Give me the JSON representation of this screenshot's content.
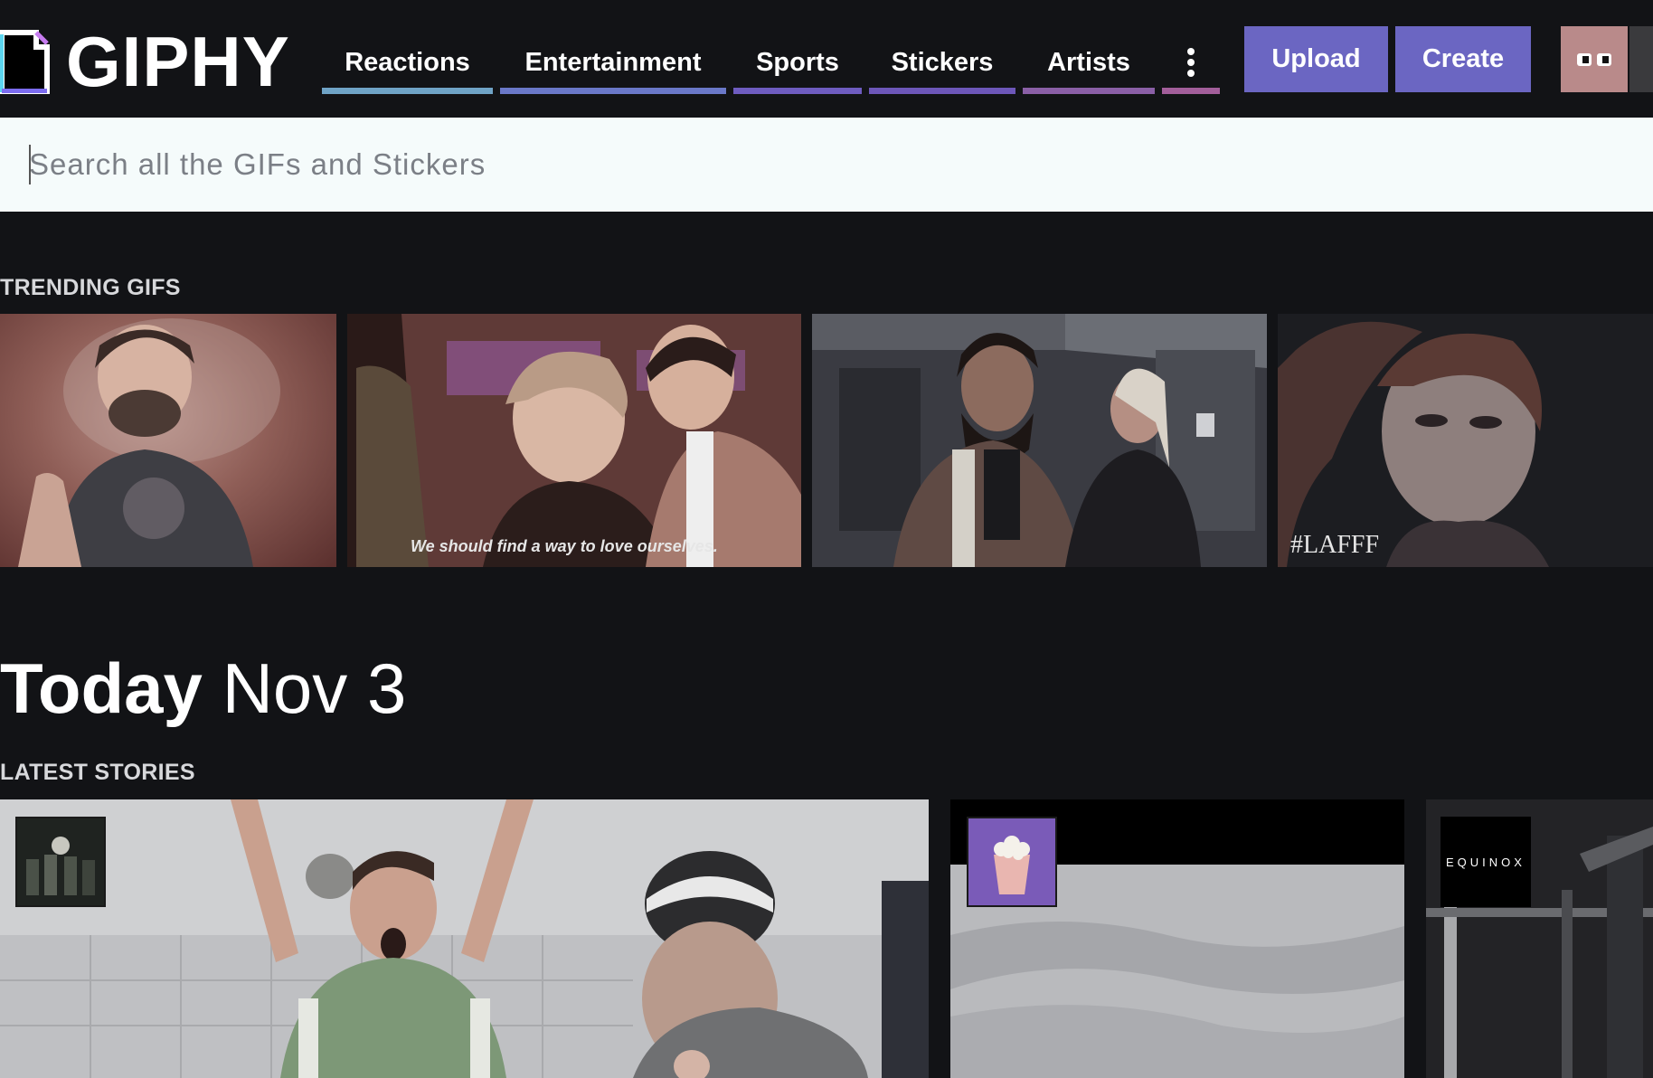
{
  "header": {
    "logo_text": "GIPHY",
    "nav": [
      {
        "label": "Reactions",
        "color": "#6fa3c6"
      },
      {
        "label": "Entertainment",
        "color": "#6a78c8"
      },
      {
        "label": "Sports",
        "color": "#6e5cc0"
      },
      {
        "label": "Stickers",
        "color": "#6d57b9"
      },
      {
        "label": "Artists",
        "color": "#8a5fa6"
      }
    ],
    "more_icon": "more-vertical-icon",
    "upload_label": "Upload",
    "create_label": "Create",
    "accent_color": "#6b66c2",
    "avatar_icon": "googly-eyes-icon"
  },
  "search": {
    "placeholder": "Search all the GIFs and Stickers",
    "value": ""
  },
  "trending": {
    "label": "TRENDING GIFS",
    "gifs": [
      {
        "caption": ""
      },
      {
        "caption": "We should find a way to love ourselves."
      },
      {
        "caption": ""
      },
      {
        "caption": "#LAFFF"
      }
    ]
  },
  "today": {
    "word": "Today",
    "date": "Nov 3"
  },
  "stories": {
    "label": "LATEST STORIES",
    "items": [
      {
        "thumb_text": ""
      },
      {
        "thumb_text": ""
      },
      {
        "thumb_text": "EQUINOX"
      }
    ]
  }
}
